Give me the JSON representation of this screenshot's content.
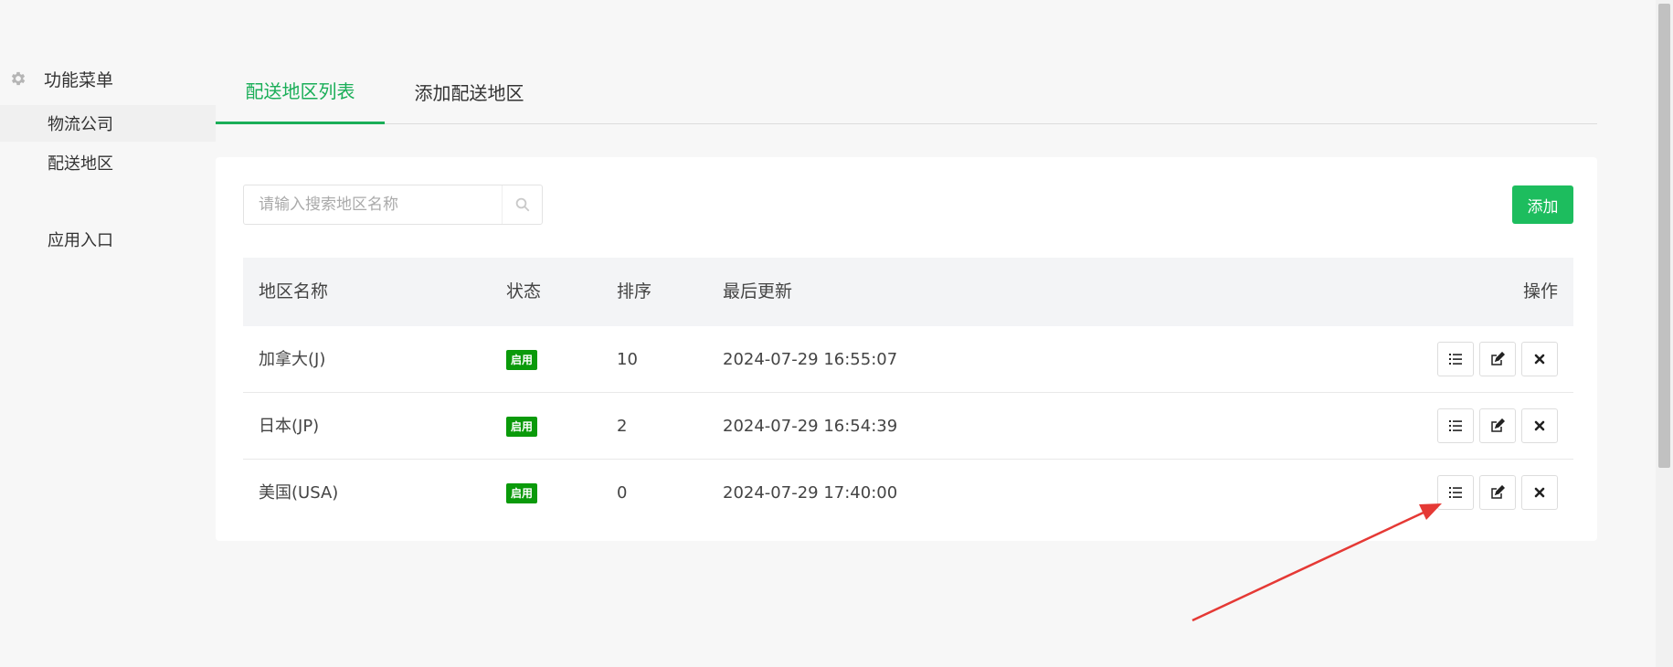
{
  "sidebar": {
    "menu_title": "功能菜单",
    "items": [
      {
        "label": "物流公司"
      },
      {
        "label": "配送地区"
      },
      {
        "label": "应用入口"
      }
    ]
  },
  "tabs": [
    {
      "label": "配送地区列表"
    },
    {
      "label": "添加配送地区"
    }
  ],
  "search": {
    "placeholder": "请输入搜索地区名称",
    "value": ""
  },
  "add_button": "添加",
  "table": {
    "headers": {
      "name": "地区名称",
      "status": "状态",
      "sort": "排序",
      "updated": "最后更新",
      "ops": "操作"
    },
    "rows": [
      {
        "name": "加拿大(J)",
        "status": "启用",
        "sort": "10",
        "updated": "2024-07-29 16:55:07"
      },
      {
        "name": "日本(JP)",
        "status": "启用",
        "sort": "2",
        "updated": "2024-07-29 16:54:39"
      },
      {
        "name": "美国(USA)",
        "status": "启用",
        "sort": "0",
        "updated": "2024-07-29 17:40:00"
      }
    ]
  },
  "colors": {
    "accent": "#1aae58",
    "add_button": "#1dbd5e",
    "badge": "#0a9a0a",
    "annotation": "#e53935"
  },
  "icons": [
    "gear-icon",
    "search-icon",
    "list-icon",
    "edit-icon",
    "close-icon"
  ]
}
